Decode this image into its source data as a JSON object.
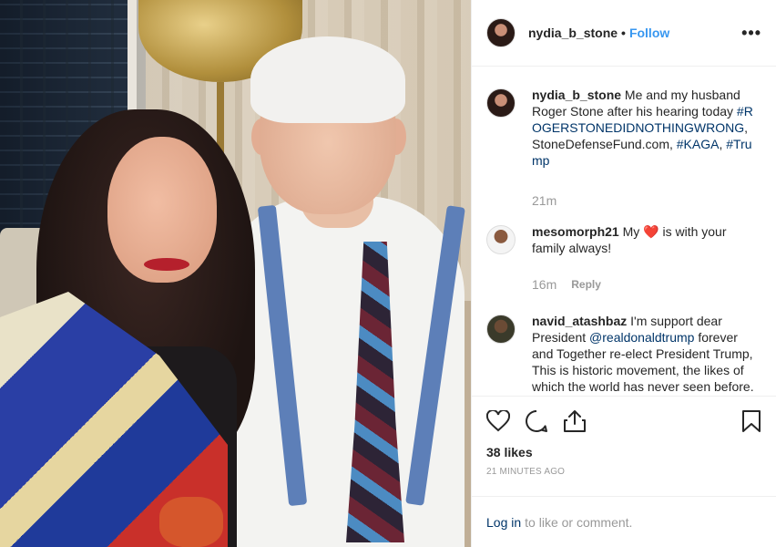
{
  "post": {
    "username": "nydia_b_stone",
    "follow_label": "Follow",
    "separator": "•",
    "more_label": "•••"
  },
  "caption": {
    "username": "nydia_b_stone",
    "text": "Me and my husband Roger Stone after his hearing today",
    "hashtag1": "#ROGERSTONEDIDNOTHINGWRONG",
    "text2": ", StoneDefenseFund.com,",
    "hashtag2": "#KAGA",
    "text3": ",",
    "hashtag3": "#Trump",
    "time": "21m"
  },
  "comments": [
    {
      "username": "mesomorph21",
      "text_before": "My",
      "emoji": "❤️",
      "text_after": "is with your family always!",
      "time": "16m",
      "reply_label": "Reply"
    },
    {
      "username": "navid_atashbaz",
      "text": "I'm support dear President",
      "mention": "@realdonaldtrump",
      "text_after": "forever and Together re-elect President Trump, This is historic movement, the likes of which the world has never seen before. We Are Going On to Victory."
    }
  ],
  "stats": {
    "likes": "38 likes",
    "time_ago": "21 MINUTES AGO"
  },
  "login": {
    "link": "Log in",
    "text": "to like or comment."
  },
  "icons": {
    "like": "heart-icon",
    "comment": "comment-icon",
    "share": "share-icon",
    "save": "bookmark-icon"
  }
}
